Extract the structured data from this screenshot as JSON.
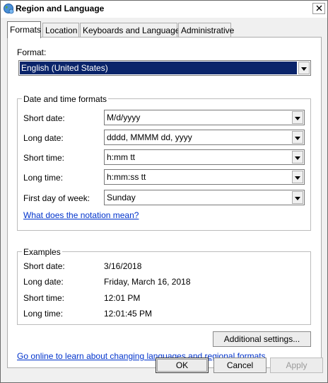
{
  "window": {
    "title": "Region and Language",
    "icon": "globe-icon",
    "close_icon": "close-icon"
  },
  "tabs": [
    {
      "label": "Formats",
      "active": true
    },
    {
      "label": "Location",
      "active": false
    },
    {
      "label": "Keyboards and Languages",
      "active": false
    },
    {
      "label": "Administrative",
      "active": false
    }
  ],
  "format": {
    "label": "Format:",
    "value": "English (United States)"
  },
  "date_time_formats": {
    "title": "Date and time formats",
    "rows": [
      {
        "label": "Short date:",
        "value": "M/d/yyyy"
      },
      {
        "label": "Long date:",
        "value": "dddd, MMMM dd, yyyy"
      },
      {
        "label": "Short time:",
        "value": "h:mm tt"
      },
      {
        "label": "Long time:",
        "value": "h:mm:ss tt"
      },
      {
        "label": "First day of week:",
        "value": "Sunday"
      }
    ],
    "notation_link": "What does the notation mean?"
  },
  "examples": {
    "title": "Examples",
    "rows": [
      {
        "label": "Short date:",
        "value": "3/16/2018"
      },
      {
        "label": "Long date:",
        "value": "Friday, March 16, 2018"
      },
      {
        "label": "Short time:",
        "value": "12:01 PM"
      },
      {
        "label": "Long time:",
        "value": "12:01:45 PM"
      }
    ]
  },
  "additional_settings_label": "Additional settings...",
  "online_link": "Go online to learn about changing languages and regional formats",
  "buttons": {
    "ok": "OK",
    "cancel": "Cancel",
    "apply": "Apply"
  },
  "colors": {
    "selection": "#0a246a",
    "link": "#0033cc",
    "face": "#f0f0f0"
  }
}
